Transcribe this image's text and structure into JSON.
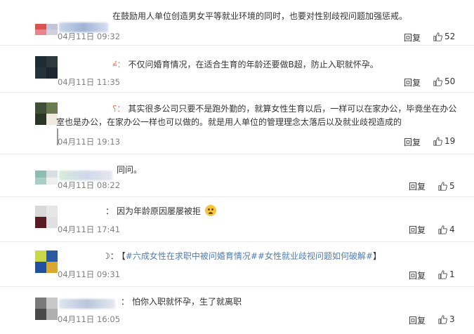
{
  "comments": [
    {
      "text": "在鼓励用人单位创造男女平等就业环境的同时，也要对性别歧视问题加强惩戒。",
      "time": "04月11日 09:32",
      "reply_label": "回复",
      "likes": "52",
      "avatar_colors": [
        "#d9524f",
        "#c4c4d8",
        "#e8848a",
        "#d0d0e0"
      ]
    },
    {
      "name_fragment": "ⰼ：",
      "text": "不仅问婚育情况，在适合生育的年龄还要做B超，防止入职就怀孕。",
      "time": "04月11日 11:35",
      "reply_label": "回复",
      "likes": "50",
      "avatar_colors": [
        "#1e2c33",
        "#2c3a40",
        "#24333a",
        "#1a2630"
      ]
    },
    {
      "name_fragment": "⸮：",
      "text": "其实很多公司只要不是跑外勤的，就算女性生育以后，一样可以在家办公，毕竟坐在办公室也是办公，在家办公一样也可以做的。就是用人单位的管理理念太落后以及就业歧视造成的",
      "time": "04月11日 19:13",
      "reply_label": "回复",
      "likes": "19",
      "avatar_colors": [
        "#3f5036",
        "#6c7a50",
        "#2a3526",
        "#f0eae0"
      ]
    },
    {
      "text": "同问。",
      "time": "04月11日 08:22",
      "reply_label": "回复",
      "likes": "5",
      "avatar_colors": [
        "#8ebdb0",
        "#d9dee0",
        "#a8cfc4",
        "#eef0f0"
      ]
    },
    {
      "name_fragment": "：",
      "text": "因为年龄原因屡屡被拒",
      "time": "04月11日 17:41",
      "reply_label": "回复",
      "likes": "4",
      "avatar_colors": [
        "#d8d8d8",
        "#e6e6e6",
        "#5a1a22",
        "#e0e0e0"
      ]
    },
    {
      "name_fragment": "☽：",
      "text_prefix": "【",
      "topic": "#六成女性在求职中被问婚育情况##女性就业歧视问题如何破解#",
      "text_suffix": "】",
      "time": "04月11日 09:31",
      "reply_label": "回复",
      "likes": "1",
      "avatar_colors": [
        "#c8d84a",
        "#2c5aa0",
        "#2050a0",
        "#d9a830"
      ]
    },
    {
      "name_fragment": "：",
      "text": "怕你入职就怀孕，生了就离职",
      "time": "04月11日 16:05",
      "reply_label": "回复",
      "likes": "3",
      "avatar_colors": [
        "#7a7a7a",
        "#c8c8c8",
        "#4a4a4a",
        "#b0b0b0"
      ]
    }
  ],
  "icons": {
    "like": "thumbs-up-icon",
    "emoji": "crying-face-emoji-icon"
  },
  "colors": {
    "text": "#333333",
    "time": "#808080",
    "topic": "#507daf",
    "divider": "#e9e9e9"
  }
}
